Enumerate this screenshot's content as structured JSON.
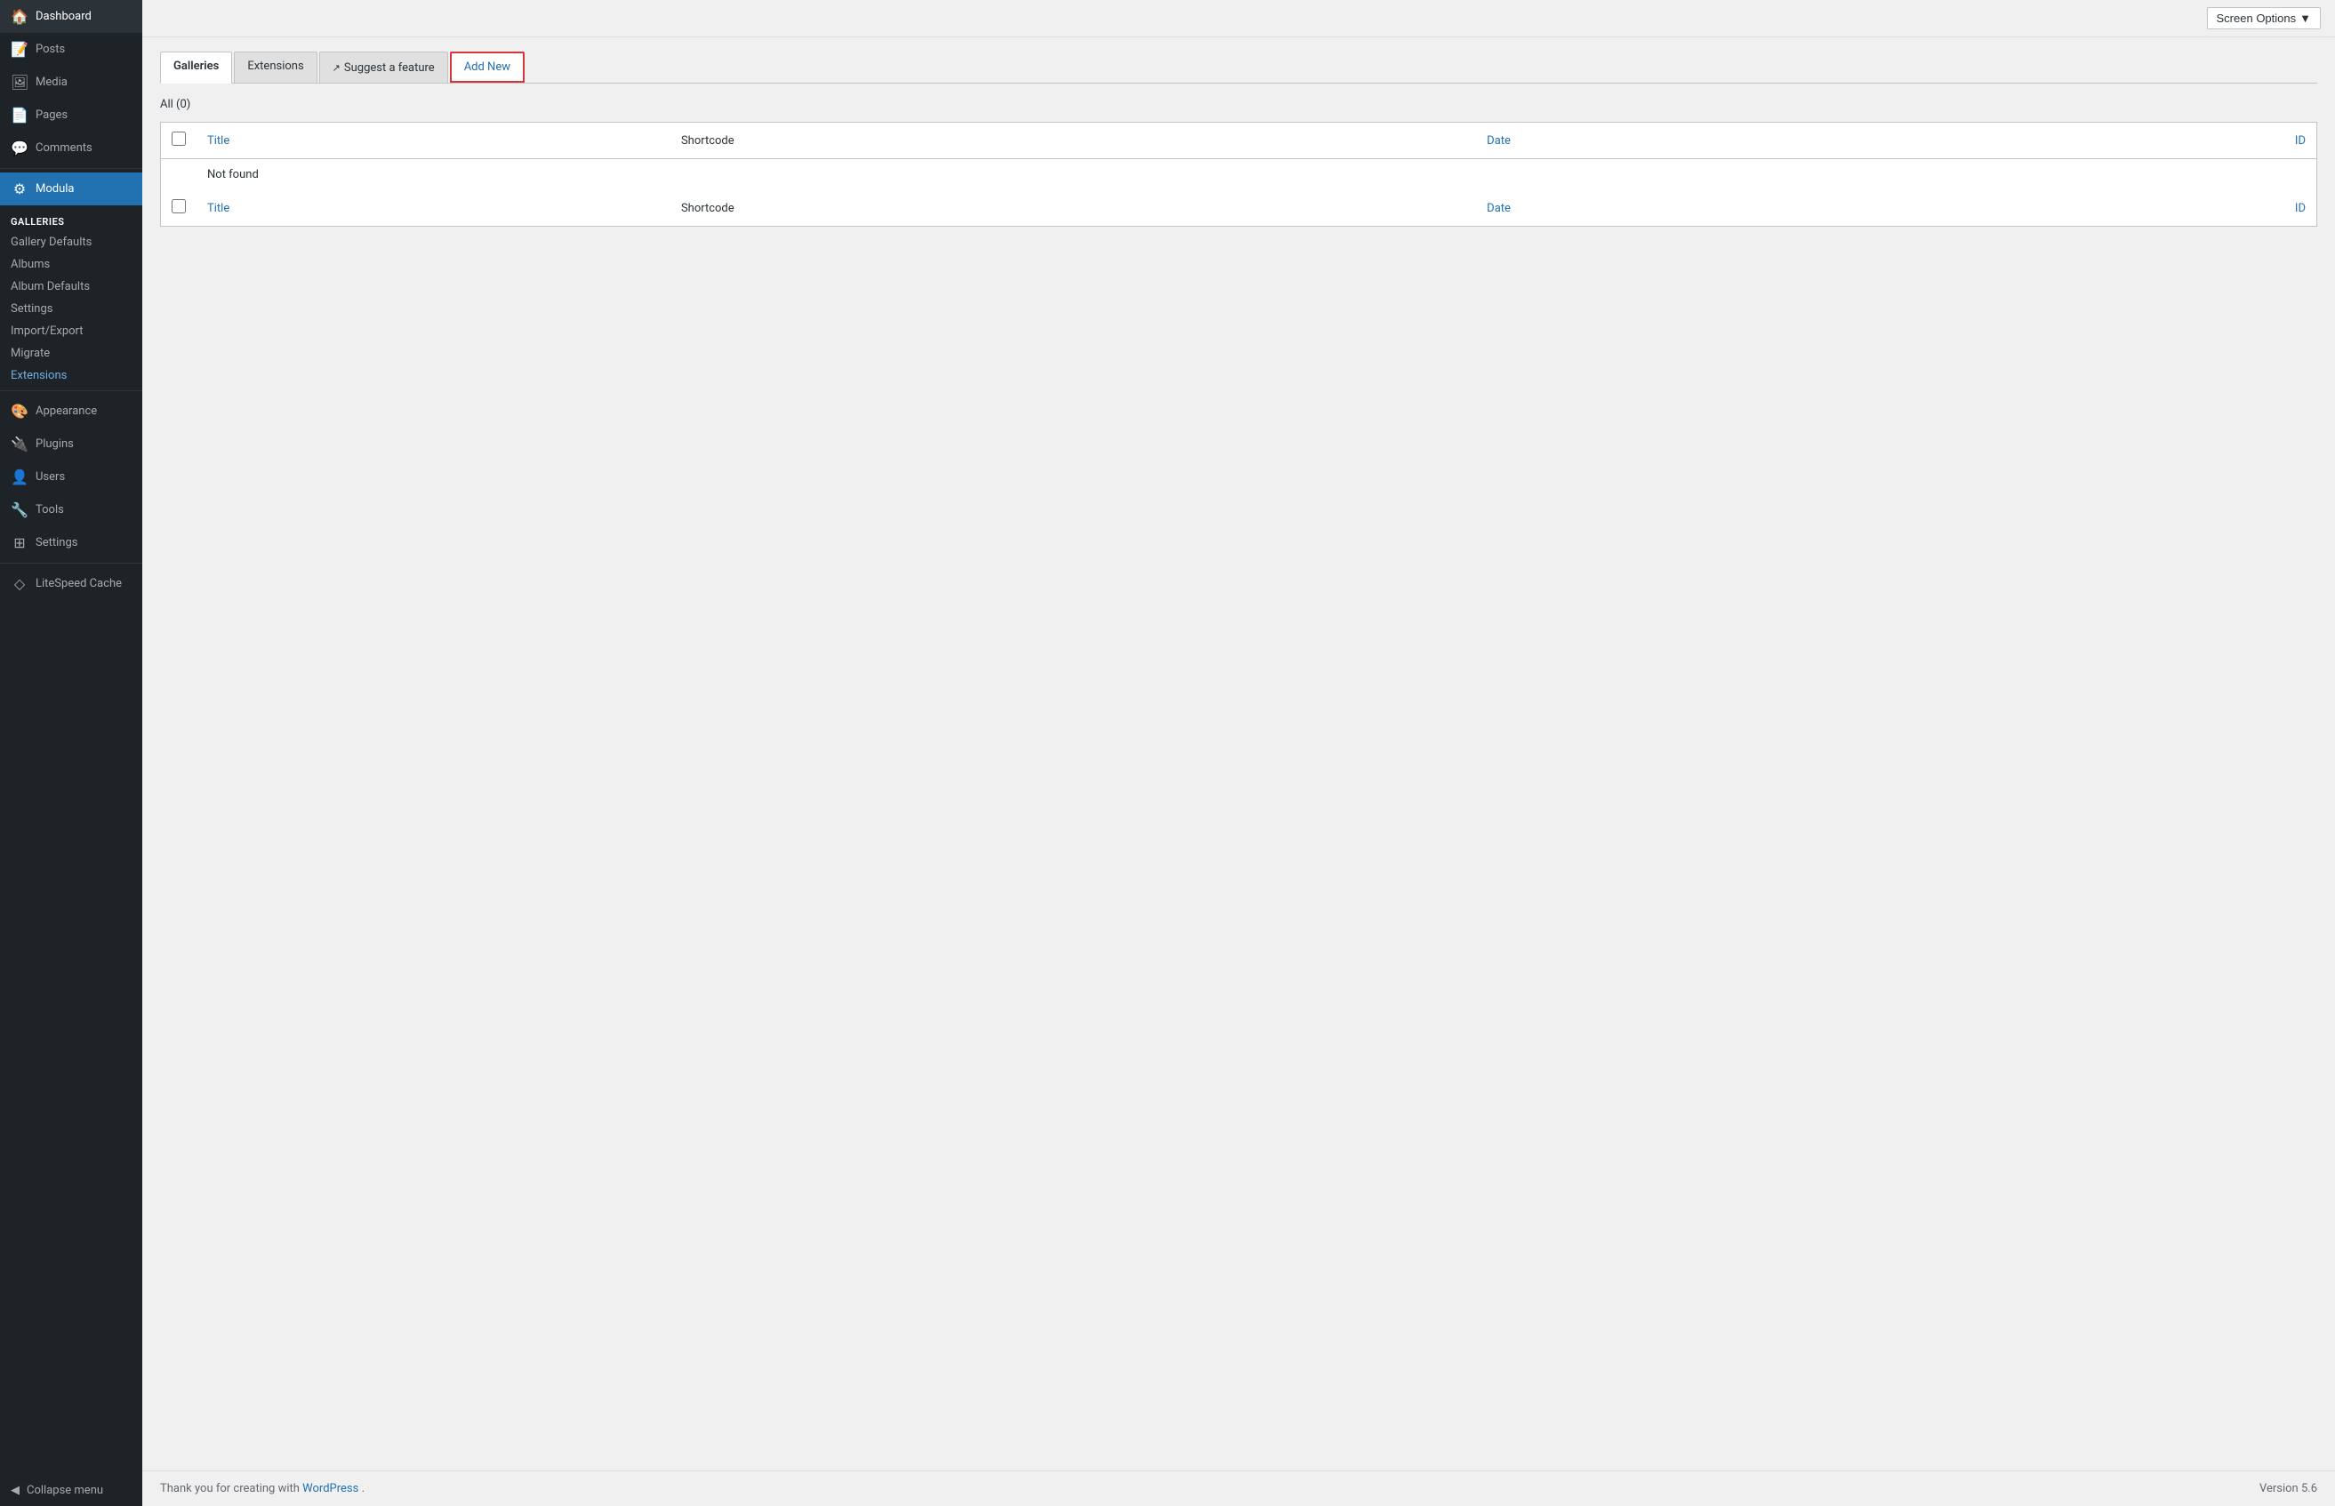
{
  "sidebar": {
    "items": [
      {
        "id": "dashboard",
        "label": "Dashboard",
        "icon": "🏠"
      },
      {
        "id": "posts",
        "label": "Posts",
        "icon": "📝"
      },
      {
        "id": "media",
        "label": "Media",
        "icon": "🖼"
      },
      {
        "id": "pages",
        "label": "Pages",
        "icon": "📄"
      },
      {
        "id": "comments",
        "label": "Comments",
        "icon": "💬"
      },
      {
        "id": "modula",
        "label": "Modula",
        "icon": "⚙",
        "active": true
      }
    ],
    "galleries_section": {
      "header": "Galleries",
      "sub_items": [
        {
          "id": "gallery-defaults",
          "label": "Gallery Defaults"
        },
        {
          "id": "albums",
          "label": "Albums"
        },
        {
          "id": "album-defaults",
          "label": "Album Defaults"
        },
        {
          "id": "settings",
          "label": "Settings"
        },
        {
          "id": "import-export",
          "label": "Import/Export"
        },
        {
          "id": "migrate",
          "label": "Migrate"
        },
        {
          "id": "extensions",
          "label": "Extensions",
          "active": true
        }
      ]
    },
    "bottom_items": [
      {
        "id": "appearance",
        "label": "Appearance",
        "icon": "🎨"
      },
      {
        "id": "plugins",
        "label": "Plugins",
        "icon": "🔌"
      },
      {
        "id": "users",
        "label": "Users",
        "icon": "👤"
      },
      {
        "id": "tools",
        "label": "Tools",
        "icon": "🔧"
      },
      {
        "id": "settings",
        "label": "Settings",
        "icon": "⊞"
      },
      {
        "id": "litespeed",
        "label": "LiteSpeed Cache",
        "icon": "◇"
      }
    ],
    "collapse_label": "Collapse menu"
  },
  "topbar": {
    "screen_options_label": "Screen Options",
    "screen_options_arrow": "▼"
  },
  "tabs": [
    {
      "id": "galleries",
      "label": "Galleries",
      "active": true
    },
    {
      "id": "extensions",
      "label": "Extensions",
      "active": false
    },
    {
      "id": "suggest",
      "label": "Suggest a feature",
      "icon": "↗",
      "active": false
    },
    {
      "id": "add-new",
      "label": "Add New",
      "active": false,
      "highlighted": true
    }
  ],
  "content": {
    "all_label": "All",
    "all_count": "(0)",
    "table": {
      "headers": [
        {
          "id": "check",
          "label": ""
        },
        {
          "id": "title",
          "label": "Title"
        },
        {
          "id": "shortcode",
          "label": "Shortcode"
        },
        {
          "id": "date",
          "label": "Date"
        },
        {
          "id": "id",
          "label": "ID"
        }
      ],
      "not_found_text": "Not found",
      "footer_headers": [
        {
          "id": "check",
          "label": ""
        },
        {
          "id": "title",
          "label": "Title"
        },
        {
          "id": "shortcode",
          "label": "Shortcode"
        },
        {
          "id": "date",
          "label": "Date"
        },
        {
          "id": "id",
          "label": "ID"
        }
      ]
    }
  },
  "footer": {
    "thank_you_text": "Thank you for creating with ",
    "wp_link_text": "WordPress",
    "wp_link_url": "https://wordpress.org",
    "version_label": "Version 5.6"
  }
}
